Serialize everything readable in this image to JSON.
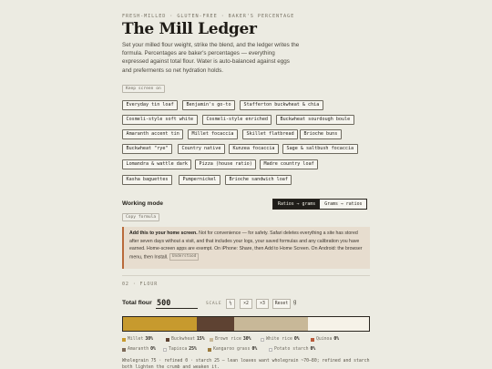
{
  "header": {
    "kicker": "FRESH-MILLED · GLUTEN-FREE · BAKER'S PERCENTAGE",
    "title": "The Mill Ledger",
    "intro": "Set your milled flour weight, strike the blend, and the ledger writes the formula. Percentages are baker's percentages — everything expressed against total flour. Water is auto-balanced against eggs and preferments so net hydration holds."
  },
  "keep_screen_label": "Keep screen on",
  "presets": [
    "Everyday tin loaf",
    "Benjamin's go-to",
    "Stafferton buckwheat & chia",
    "Cosmeli-style soft white",
    "Cosmeli-style enriched",
    "Buckwheat sourdough boule",
    "Amaranth accent tin",
    "Millet focaccia",
    "Skillet flatbread",
    "Brioche buns",
    "Buckwheat \"rye\"",
    "Country native",
    "Kunzea focaccia",
    "Sage & saltbush focaccia",
    "Lomandra & wattle dark",
    "Pizza (house ratio)",
    "Madre country loaf",
    "Kasha baguettes",
    "Pumpernickel",
    "Brioche sandwich loaf"
  ],
  "working_mode": {
    "label": "Working mode",
    "options": [
      "Ratios → grams",
      "Grams → ratios"
    ],
    "selected": "Ratios → grams",
    "copy_label": "Copy formula"
  },
  "notice": {
    "strong": "Add this to your home screen.",
    "text": " Not for convenience — for safety. Safari deletes everything a site has stored after seven days without a visit, and that includes your logs, your saved formulas and any calibration you have earned. Home-screen apps are exempt. On iPhone: Share, then Add to Home Screen. On Android: the browser menu, then Install.",
    "dismiss": "Understood"
  },
  "flour": {
    "kicker": "02 · FLOUR",
    "total_label": "Total flour",
    "total_value": "500",
    "scale_label": "SCALE",
    "scale_buttons": [
      "½",
      "×2",
      "×3",
      "Reset"
    ],
    "unit": "g"
  },
  "blend": [
    {
      "name": "Millet",
      "pct": "30%",
      "value": 30,
      "color": "#c79a2e"
    },
    {
      "name": "Buckwheat",
      "pct": "15%",
      "value": 15,
      "color": "#5e4232"
    },
    {
      "name": "Brown rice",
      "pct": "30%",
      "value": 30,
      "color": "#c8b898"
    },
    {
      "name": "White rice",
      "pct": "0%",
      "value": 0,
      "color": "#f3efe4"
    },
    {
      "name": "Quinoa",
      "pct": "0%",
      "value": 0,
      "color": "#b95a3a"
    },
    {
      "name": "Amaranth",
      "pct": "0%",
      "value": 0,
      "color": "#7d6a58"
    },
    {
      "name": "Tapioca",
      "pct": "25%",
      "value": 25,
      "color": "#f6f2e8"
    },
    {
      "name": "Kangaroo grass",
      "pct": "0%",
      "value": 0,
      "color": "#9c7b3c"
    },
    {
      "name": "Potato starch",
      "pct": "0%",
      "value": 0,
      "color": "#f4f1ea"
    }
  ],
  "footnote": "Wholegrain 75 · refined 0 · starch 25 — lean loaves want wholegrain ~70–80; refined and starch both lighten the crumb and weaken it."
}
